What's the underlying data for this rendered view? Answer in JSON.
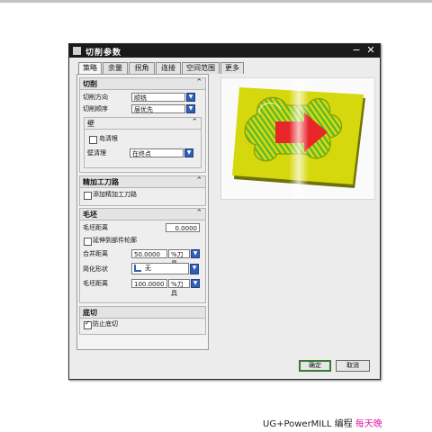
{
  "window": {
    "title": "切削参数",
    "minimize": "−",
    "close": "✕"
  },
  "tabs": [
    {
      "label": "策略",
      "active": true
    },
    {
      "label": "余量"
    },
    {
      "label": "拐角"
    },
    {
      "label": "连接"
    },
    {
      "label": "空间范围"
    },
    {
      "label": "更多"
    }
  ],
  "sections": {
    "cut": {
      "title": "切削",
      "cut_direction": {
        "label": "切削方向",
        "value": "顺铣"
      },
      "cut_order": {
        "label": "切削顺序",
        "value": "层优先"
      },
      "wall": {
        "title": "壁",
        "island_cleanup": {
          "label": "岛清根",
          "checked": false
        },
        "wall_cleanup": {
          "label": "壁清理",
          "value": "在终点"
        }
      }
    },
    "finish": {
      "title": "精加工刀路",
      "add_finish": {
        "label": "添加精加工刀路",
        "checked": false
      }
    },
    "blank": {
      "title": "毛坯",
      "blank_distance": {
        "label": "毛坯距离",
        "value": "0.0000"
      },
      "extend_to_part": {
        "label": "延伸到部件轮廓",
        "checked": false
      },
      "merge_distance": {
        "label": "合并距离",
        "value": "50.0000",
        "unit": "%刀具"
      },
      "simplify_shape": {
        "label": "简化形状",
        "value": "无"
      },
      "min_cut_length": {
        "label": "毛坯距离",
        "value": "100.0000",
        "unit": "%刀具"
      }
    },
    "undercut": {
      "title": "底切",
      "prevent_undercut": {
        "label": "防止底切",
        "checked": true
      }
    }
  },
  "buttons": {
    "ok": "确定",
    "cancel": "取消"
  },
  "caption": {
    "brand": "UG+PowerMILL 编程",
    "highlight": "每天晚"
  },
  "colors": {
    "part_yellow": "#d6d80e",
    "stripe_green": "#52b830",
    "arrow_red": "#e8262a",
    "accent_blue": "#2f5fb8"
  },
  "icons": [
    "dialog-icon",
    "minimize-icon",
    "close-icon",
    "chevron-up-icon",
    "dropdown-arrow-icon",
    "check-icon"
  ]
}
